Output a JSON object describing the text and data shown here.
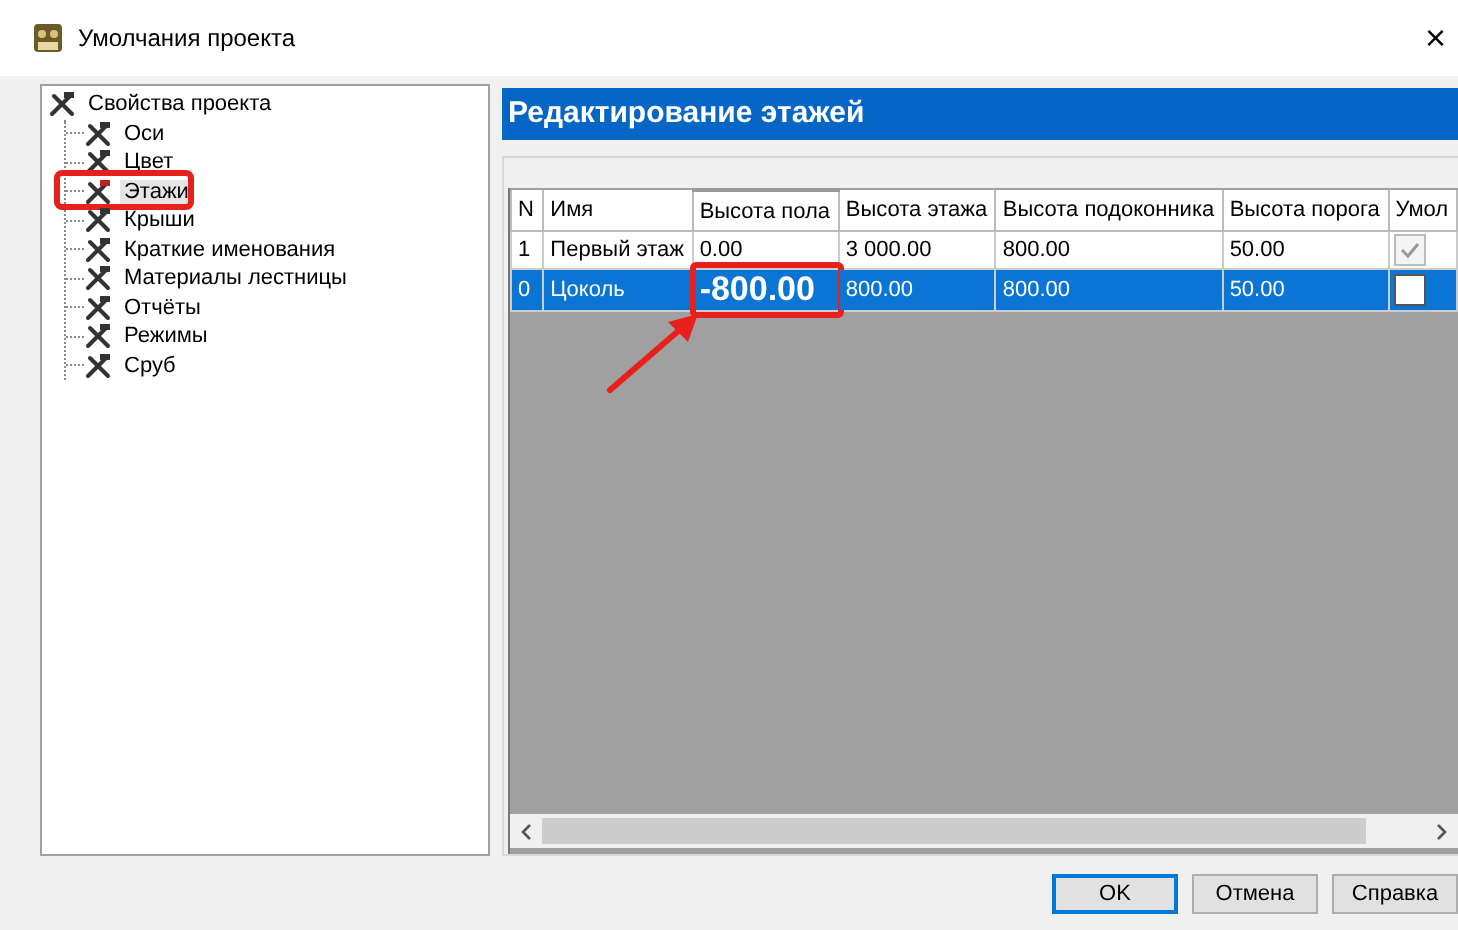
{
  "window": {
    "title": "Умолчания проекта",
    "close": "×"
  },
  "tree": {
    "label": "Свойства проекта",
    "children": [
      {
        "label": "Оси",
        "selected": false,
        "highlighted": false
      },
      {
        "label": "Цвет",
        "selected": false,
        "highlighted": false
      },
      {
        "label": "Этажи",
        "selected": true,
        "highlighted": true
      },
      {
        "label": "Крыши",
        "selected": false,
        "highlighted": false
      },
      {
        "label": "Краткие именования",
        "selected": false,
        "highlighted": false
      },
      {
        "label": "Материалы лестницы",
        "selected": false,
        "highlighted": false
      },
      {
        "label": "Отчёты",
        "selected": false,
        "highlighted": false
      },
      {
        "label": "Режимы",
        "selected": false,
        "highlighted": false
      },
      {
        "label": "Сруб",
        "selected": false,
        "highlighted": false
      }
    ]
  },
  "section_title": "Редактирование этажей",
  "table": {
    "columns": [
      "N",
      "Имя",
      "Высота пола",
      "Высота этажа",
      "Высота подоконника",
      "Высота порога",
      "Умол"
    ],
    "rows": [
      {
        "selected": false,
        "cells": [
          {
            "text": "1",
            "edited": false
          },
          {
            "text": "Первый этаж",
            "edited": false
          },
          {
            "text": "0.00",
            "edited": false
          },
          {
            "text": "3 000.00",
            "edited": false
          },
          {
            "text": "800.00",
            "edited": false
          },
          {
            "text": "50.00",
            "edited": false
          }
        ],
        "default": true,
        "default_disabled": true
      },
      {
        "selected": true,
        "cells": [
          {
            "text": "0",
            "edited": false
          },
          {
            "text": "Цоколь",
            "edited": false
          },
          {
            "text": "-800.00",
            "edited": true
          },
          {
            "text": "800.00",
            "edited": false
          },
          {
            "text": "800.00",
            "edited": false
          },
          {
            "text": "50.00",
            "edited": false
          }
        ],
        "default": false,
        "default_disabled": false
      }
    ]
  },
  "callout_arrow": true,
  "buttons": [
    {
      "label": "OK",
      "focused": true
    },
    {
      "label": "Отмена",
      "focused": false
    },
    {
      "label": "Справка",
      "focused": false
    }
  ]
}
